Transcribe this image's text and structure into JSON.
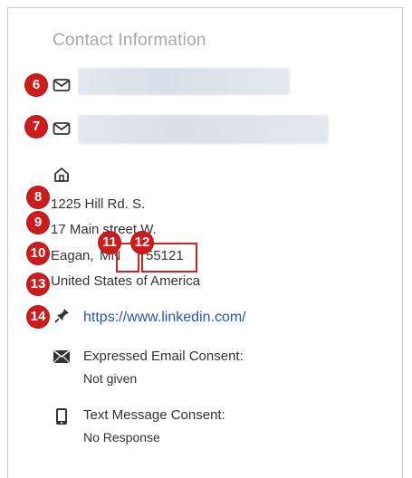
{
  "panel": {
    "title": "Contact Information"
  },
  "annotations": {
    "b6": "6",
    "b7": "7",
    "b8": "8",
    "b9": "9",
    "b10": "10",
    "b11": "11",
    "b12": "12",
    "b13": "13",
    "b14": "14"
  },
  "address": {
    "line1": "1225 Hill Rd. S.",
    "line2": "17 Main street W.",
    "city": "Eagan,",
    "state": "MN",
    "zip": "55121",
    "country": "United States of America"
  },
  "website": {
    "url": "https://www.linkedin.com/"
  },
  "email_consent": {
    "label": "Expressed Email Consent:",
    "value": "Not given"
  },
  "text_consent": {
    "label": "Text Message Consent:",
    "value": "No Response"
  },
  "icons": {
    "email1": "mail-icon",
    "email2": "mail-icon",
    "address": "home-icon",
    "website": "pin-icon",
    "email_consent": "envelope-icon",
    "text_consent": "mobile-phone-icon"
  },
  "colors": {
    "badge": "#cc1c1c",
    "link": "#2657b5",
    "title": "#a7a7a7"
  }
}
